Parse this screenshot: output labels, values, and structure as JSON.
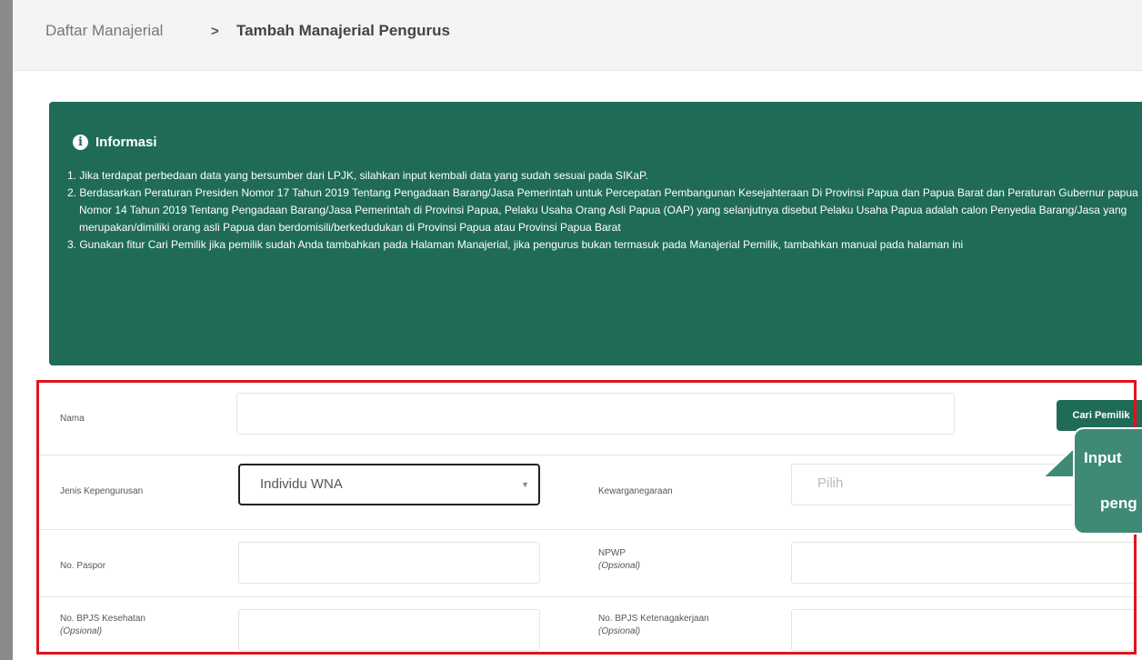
{
  "breadcrumb": {
    "parent": "Daftar Manajerial",
    "separator": ">",
    "current": "Tambah Manajerial Pengurus"
  },
  "info": {
    "title": "Informasi",
    "items": [
      "1. Jika terdapat perbedaan data yang bersumber dari LPJK, silahkan input kembali data yang sudah sesuai pada SIKaP.",
      "2. Berdasarkan Peraturan Presiden Nomor 17 Tahun 2019 Tentang Pengadaan Barang/Jasa Pemerintah untuk Percepatan Pembangunan Kesejahteraan Di Provinsi Papua dan Papua Barat dan Peraturan Gubernur papua Nomor 14 Tahun 2019 Tentang Pengadaan Barang/Jasa Pemerintah di Provinsi Papua, Pelaku Usaha Orang Asli Papua (OAP) yang selanjutnya disebut Pelaku Usaha Papua adalah calon Penyedia Barang/Jasa yang merupakan/dimiliki orang asli Papua dan berdomisili/berkedudukan di Provinsi Papua atau Provinsi Papua Barat",
      "3. Gunakan fitur Cari Pemilik jika pemilik sudah Anda tambahkan pada Halaman Manajerial, jika pengurus bukan termasuk pada Manajerial Pemilik, tambahkan manual pada halaman ini"
    ]
  },
  "form": {
    "nama_label": "Nama",
    "nama_value": "",
    "cari_pemilik_button": "Cari Pemilik",
    "jenis_label": "Jenis Kepengurusan",
    "jenis_value": "Individu WNA",
    "kewarganegaraan_label": "Kewarganegaraan",
    "kewarganegaraan_placeholder": "Pilih",
    "paspor_label": "No. Paspor",
    "npwp_label": "NPWP",
    "npwp_note": "(Opsional)",
    "bpjs_kes_label": "No. BPJS Kesehatan",
    "bpjs_kes_note": "(Opsional)",
    "bpjs_tk_label": "No. BPJS Ketenagakerjaan",
    "bpjs_tk_note": "(Opsional)"
  },
  "callout": {
    "line1": "Input",
    "line2": "peng"
  },
  "colors": {
    "primary": "#1f6b57",
    "highlight": "#e0141d",
    "callout": "#3f8a76"
  }
}
